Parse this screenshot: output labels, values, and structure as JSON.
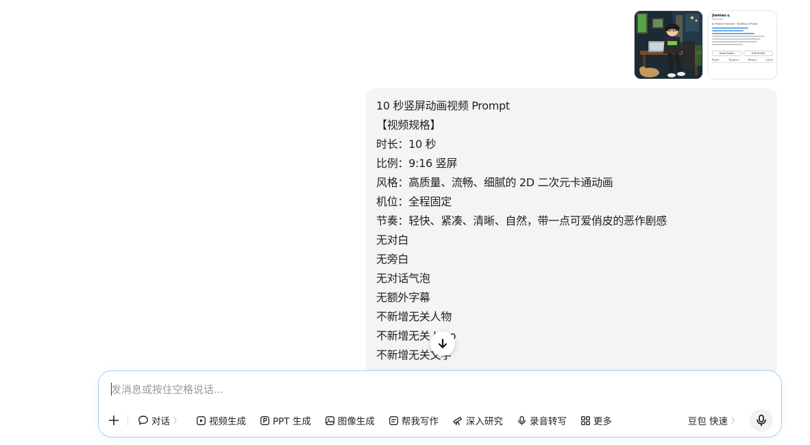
{
  "attachments": {
    "profile": {
      "name": "Jiamiao",
      "handle": "@founder",
      "bio": "AI Product Founder · Building in Public",
      "share_label": "Share Profile",
      "edit_label": "Edit Profile",
      "tabs": [
        "Posts",
        "Replies",
        "Media",
        "Likes"
      ]
    }
  },
  "message": {
    "lines": [
      "10 秒竖屏动画视频 Prompt",
      "【视频规格】",
      "时长：10 秒",
      "比例：9:16 竖屏",
      "风格：高质量、流畅、细腻的 2D 二次元卡通动画",
      "机位：全程固定",
      "节奏：轻快、紧凑、清晰、自然，带一点可爱俏皮的恶作剧感",
      "无对白",
      "无旁白",
      "无对话气泡",
      "无额外字幕",
      "不新增无关人物",
      "不新增无关 logo",
      "不新增无关文字"
    ]
  },
  "composer": {
    "placeholder": "发消息或按住空格说话...",
    "tools": {
      "add": "+",
      "chat": "对话",
      "video": "视频生成",
      "ppt": "PPT 生成",
      "image": "图像生成",
      "write": "帮我写作",
      "research": "深入研究",
      "transcribe": "录音转写",
      "more": "更多"
    },
    "model": "豆包 快速"
  },
  "colors": {
    "bubble_bg": "#f4f4f5",
    "composer_border": "#a9cdf2"
  }
}
